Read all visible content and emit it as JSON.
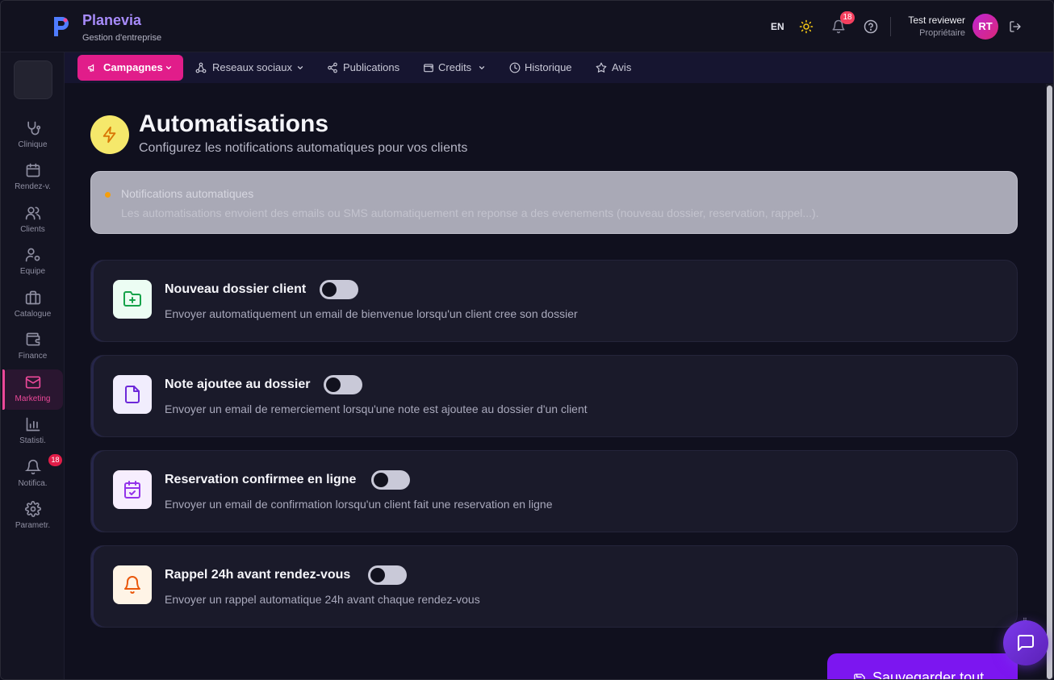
{
  "brand": {
    "name": "Planevia",
    "subtitle": "Gestion d'entreprise"
  },
  "topbar": {
    "language": "EN",
    "notification_count": "18",
    "user_name": "Test reviewer",
    "user_role": "Propriétaire",
    "avatar_initials": "RT"
  },
  "sidebar": {
    "items": [
      {
        "label": "Clinique",
        "icon": "stethoscope-icon"
      },
      {
        "label": "Rendez-v.",
        "icon": "calendar-icon"
      },
      {
        "label": "Clients",
        "icon": "users-icon"
      },
      {
        "label": "Equipe",
        "icon": "team-settings-icon"
      },
      {
        "label": "Catalogue",
        "icon": "briefcase-icon"
      },
      {
        "label": "Finance",
        "icon": "wallet-icon"
      },
      {
        "label": "Marketing",
        "icon": "mail-icon",
        "active": true
      },
      {
        "label": "Statisti.",
        "icon": "bar-chart-icon"
      },
      {
        "label": "Notifica.",
        "icon": "bell-icon",
        "badge": "18"
      },
      {
        "label": "Parametr.",
        "icon": "gear-icon"
      }
    ]
  },
  "tabs": [
    {
      "label": "Campagnes",
      "icon": "megaphone-icon",
      "active": true,
      "dropdown": true
    },
    {
      "label": "Reseaux sociaux",
      "icon": "network-icon",
      "dropdown": true
    },
    {
      "label": "Publications",
      "icon": "share-icon"
    },
    {
      "label": "Credits",
      "icon": "wallet-icon",
      "dropdown": true
    },
    {
      "label": "Historique",
      "icon": "clock-icon"
    },
    {
      "label": "Avis",
      "icon": "star-icon"
    }
  ],
  "page": {
    "title": "Automatisations",
    "subtitle": "Configurez les notifications automatiques pour vos clients"
  },
  "info": {
    "title": "Notifications automatiques",
    "text": "Les automatisations envoient des emails ou SMS automatiquement en reponse a des evenements (nouveau dossier, reservation, rappel...)."
  },
  "automations": [
    {
      "title": "Nouveau dossier client",
      "description": "Envoyer automatiquement un email de bienvenue lorsqu'un client cree son dossier",
      "enabled": false,
      "icon": "folder-plus-icon",
      "color": "#16a34a"
    },
    {
      "title": "Note ajoutee au dossier",
      "description": "Envoyer un email de remerciement lorsqu'une note est ajoutee au dossier d'un client",
      "enabled": false,
      "icon": "file-icon",
      "color": "#6d28d9"
    },
    {
      "title": "Reservation confirmee en ligne",
      "description": "Envoyer un email de confirmation lorsqu'un client fait une reservation en ligne",
      "enabled": false,
      "icon": "calendar-check-icon",
      "color": "#9333ea"
    },
    {
      "title": "Rappel 24h avant rendez-vous",
      "description": "Envoyer un rappel automatique 24h avant chaque rendez-vous",
      "enabled": false,
      "icon": "bell-icon",
      "color": "#ea580c"
    }
  ],
  "actions": {
    "save_label": "Sauvegarder tout"
  },
  "colors": {
    "accent": "#e11d8a",
    "primary": "#7c16f0",
    "brand": "#a78bfa"
  }
}
